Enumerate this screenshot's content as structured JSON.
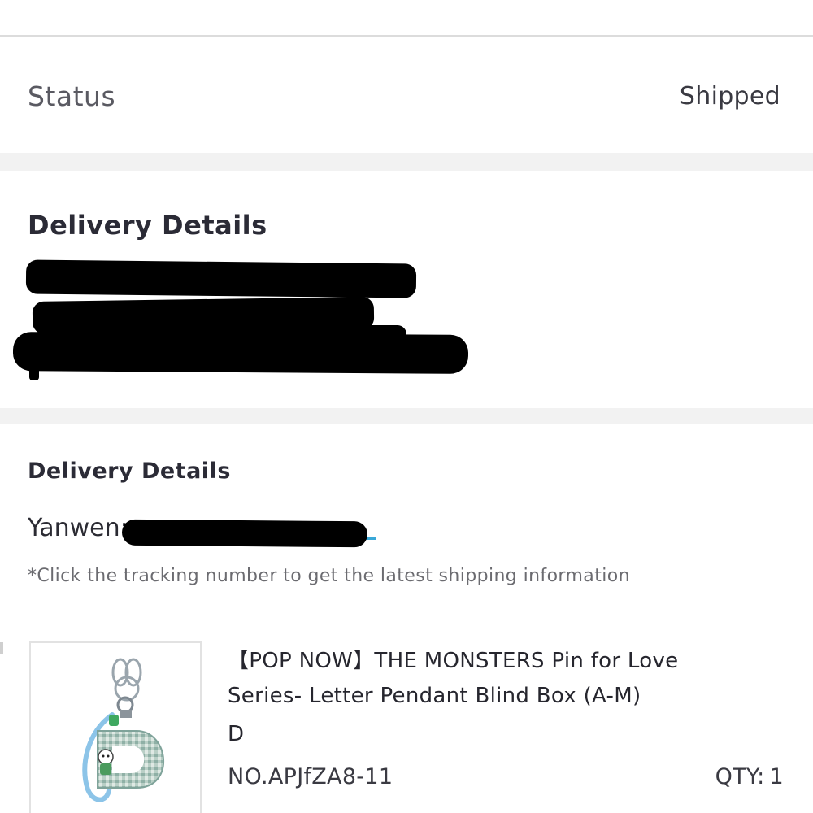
{
  "status": {
    "label": "Status",
    "value": "Shipped"
  },
  "address": {
    "title": "Delivery Details"
  },
  "shipping": {
    "title": "Delivery Details",
    "carrier": "Yanwen:",
    "hint": "*Click the tracking number to get the latest shipping information"
  },
  "product": {
    "icon": "letter-pendant-keychain-image",
    "name": "【POP NOW】THE MONSTERS Pin for Love Series- Letter Pendant Blind Box (A-M)",
    "variant": "D",
    "sku": "NO.APJfZA8-11",
    "qty_label": "QTY:",
    "qty_value": "1"
  },
  "colors": {
    "link": "#39a8d8",
    "section_gap": "#f2f2f2",
    "redaction": "#000000"
  }
}
